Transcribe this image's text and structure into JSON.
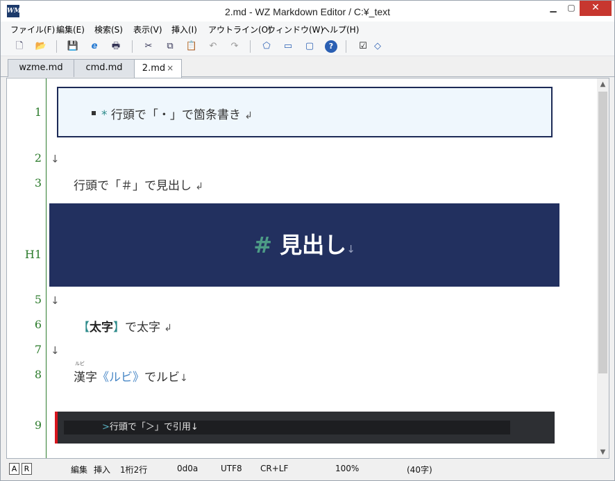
{
  "window": {
    "title": "2.md - WZ Markdown Editor / C:¥_text",
    "icon_text": "WM"
  },
  "menu": [
    {
      "label": "ファイル(F)"
    },
    {
      "label": "編集(E)"
    },
    {
      "label": "検索(S)"
    },
    {
      "label": "表示(V)"
    },
    {
      "label": "挿入(I)"
    },
    {
      "label": "アウトライン(O)"
    },
    {
      "label": "ウィンドウ(W)"
    },
    {
      "label": "ヘルプ(H)"
    }
  ],
  "toolbar": {
    "icons": [
      "new-file-icon",
      "open-folder-icon",
      "save-icon",
      "browser-icon",
      "print-icon",
      "cut-icon",
      "copy-icon",
      "paste-icon",
      "undo-icon",
      "redo-icon",
      "pentagon-icon",
      "panel-icon",
      "window-icon",
      "help-icon",
      "checkbox-icon",
      "diamond-icon"
    ],
    "glyphs": {
      "new": "🗋",
      "open": "📂",
      "save": "💾",
      "browser": "e",
      "print": "🖶",
      "cut": "✂",
      "copy": "⧉",
      "paste": "📋",
      "undo": "↶",
      "redo": "↷",
      "pentagon": "⬠",
      "panel": "▭",
      "window": "▢",
      "help": "?",
      "check": "☑",
      "diamond": "◇"
    }
  },
  "tabs": [
    {
      "label": "wzme.md",
      "active": false
    },
    {
      "label": "cmd.md",
      "active": false
    },
    {
      "label": "2.md",
      "active": true,
      "close": "×"
    }
  ],
  "editor": {
    "lines": [
      {
        "number": "1",
        "prefix": "* ",
        "text": "行頭で「・」で箇条書き",
        "eol": "↲"
      },
      {
        "number": "2",
        "eol": "↓"
      },
      {
        "number": "3",
        "text": "行頭で「＃」で見出し",
        "eol": "↲"
      },
      {
        "number": "H1",
        "prefix": "# ",
        "text": "見出し",
        "eol": "↓"
      },
      {
        "number": "5",
        "eol": "↓"
      },
      {
        "number": "6",
        "open": "【",
        "bold": "太字",
        "close": "】",
        "text": "で太字",
        "eol": "↲"
      },
      {
        "number": "7",
        "eol": "↓"
      },
      {
        "number": "8",
        "base": "漢字",
        "ruby": "ルビ",
        "open": "《",
        "inner": "ルビ",
        "close": "》",
        "text": "でルビ",
        "eol": "↓"
      },
      {
        "number": "9",
        "prefix": ">",
        "text": "行頭で「＞」で引用",
        "eol": "↓"
      }
    ]
  },
  "statusbar": {
    "btn_a": "A",
    "btn_r": "R",
    "mode_edit": "編集",
    "mode_insert": "挿入",
    "position": "1桁2行",
    "char_code": "0d0a",
    "encoding": "UTF8",
    "line_ending": "CR+LF",
    "zoom": "100%",
    "char_count": "(40字)"
  },
  "colors": {
    "accent_green": "#2a7a2a",
    "heading_bg": "#22305f",
    "quote_border": "#d7141c",
    "close_button": "#c7372f"
  }
}
